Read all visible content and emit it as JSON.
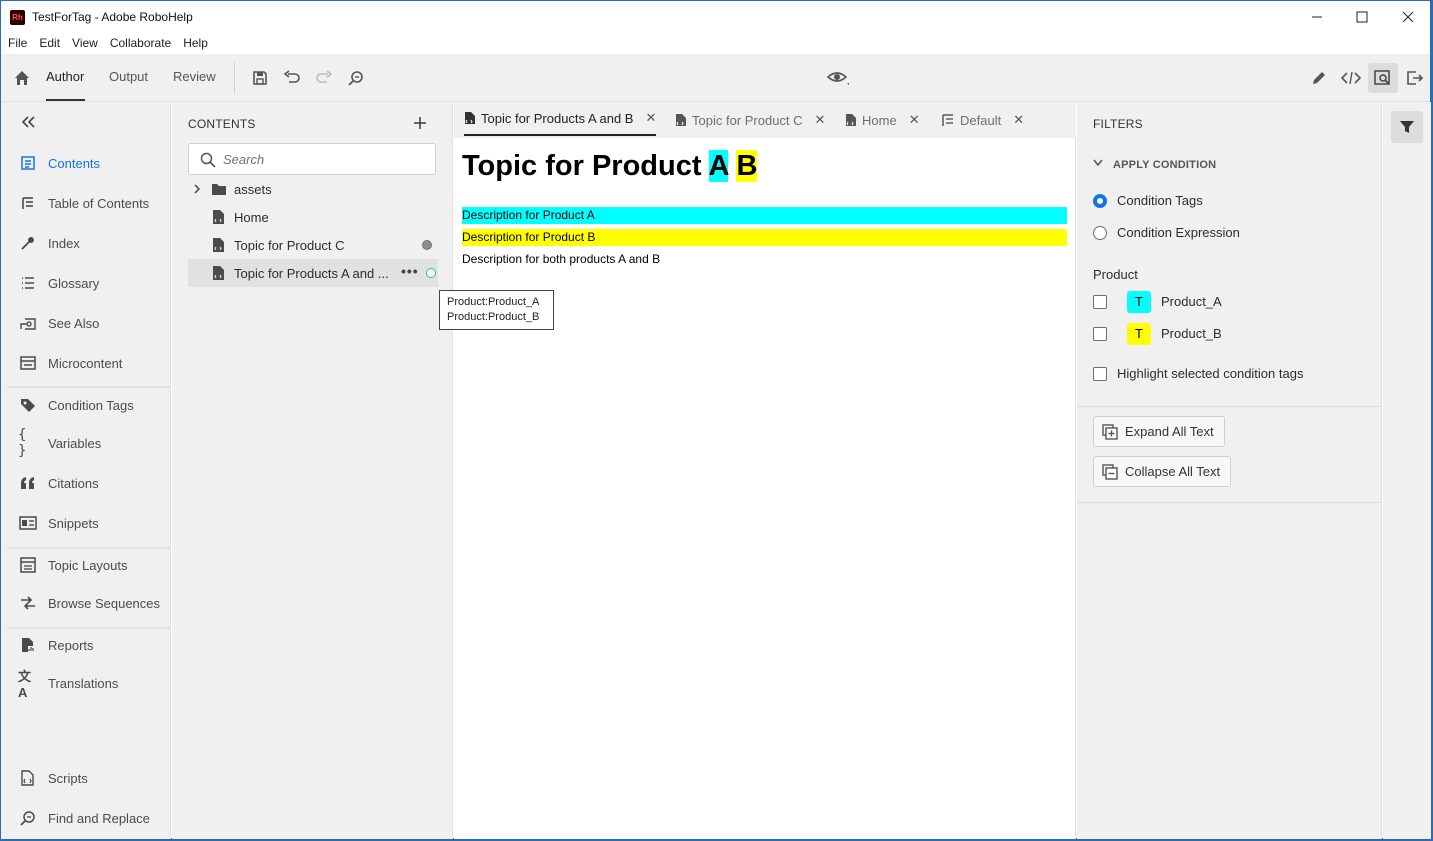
{
  "window": {
    "title": "TestForTag - Adobe RoboHelp",
    "app_icon_text": "Rh"
  },
  "menubar": [
    "File",
    "Edit",
    "View",
    "Collaborate",
    "Help"
  ],
  "toolbar": {
    "tabs": [
      "Author",
      "Output",
      "Review"
    ],
    "active_tab": "Author"
  },
  "leftnav": {
    "items": [
      {
        "label": "Contents",
        "icon": "contents-icon",
        "active": true
      },
      {
        "label": "Table of Contents",
        "icon": "toc-icon"
      },
      {
        "label": "Index",
        "icon": "index-icon"
      },
      {
        "label": "Glossary",
        "icon": "glossary-icon"
      },
      {
        "label": "See Also",
        "icon": "see-also-icon"
      },
      {
        "label": "Microcontent",
        "icon": "microcontent-icon"
      },
      {
        "label": "Condition Tags",
        "icon": "tag-icon"
      },
      {
        "label": "Variables",
        "icon": "braces-icon"
      },
      {
        "label": "Citations",
        "icon": "quote-icon"
      },
      {
        "label": "Snippets",
        "icon": "snippet-icon"
      },
      {
        "label": "Topic Layouts",
        "icon": "layout-icon"
      },
      {
        "label": "Browse Sequences",
        "icon": "sequence-icon"
      },
      {
        "label": "Reports",
        "icon": "reports-icon"
      },
      {
        "label": "Translations",
        "icon": "translate-icon"
      },
      {
        "label": "Scripts",
        "icon": "script-icon"
      },
      {
        "label": "Find and Replace",
        "icon": "find-replace-icon"
      }
    ]
  },
  "contents": {
    "title": "CONTENTS",
    "search_placeholder": "Search",
    "tree": [
      {
        "label": "assets",
        "type": "folder"
      },
      {
        "label": "Home",
        "type": "topic"
      },
      {
        "label": "Topic for Product C",
        "type": "topic",
        "status": "grey"
      },
      {
        "label": "Topic for Products A and ...",
        "type": "topic",
        "status": "green",
        "selected": true
      }
    ]
  },
  "editor": {
    "tabs": [
      {
        "label": "Topic for Products A and B",
        "active": true
      },
      {
        "label": "Topic for Product C"
      },
      {
        "label": "Home"
      },
      {
        "label": "Default"
      }
    ],
    "heading_prefix": "Topic for Product ",
    "heading_a": "A",
    "heading_b": "B",
    "paragraphs": [
      {
        "text": "Description for Product A",
        "highlight": "#00ffff"
      },
      {
        "text": "Description for Product B",
        "highlight": "#ffff00"
      },
      {
        "text": "Description for both products A and B",
        "highlight": ""
      }
    ]
  },
  "tooltip": {
    "line1": "Product:Product_A",
    "line2": "Product:Product_B"
  },
  "filters": {
    "title": "FILTERS",
    "apply_condition": "APPLY CONDITION",
    "radio_tags": "Condition Tags",
    "radio_expression": "Condition Expression",
    "group_label": "Product",
    "tags": [
      {
        "chip": "T",
        "label": "Product_A",
        "color": "#00ffff"
      },
      {
        "chip": "T",
        "label": "Product_B",
        "color": "#ffff00"
      }
    ],
    "highlight_label": "Highlight selected condition tags",
    "expand_button": "Expand All Text",
    "collapse_button": "Collapse All Text"
  },
  "colors": {
    "accent": "#1473e6",
    "status_green": "#34c759",
    "status_grey": "#8e8e8e"
  }
}
